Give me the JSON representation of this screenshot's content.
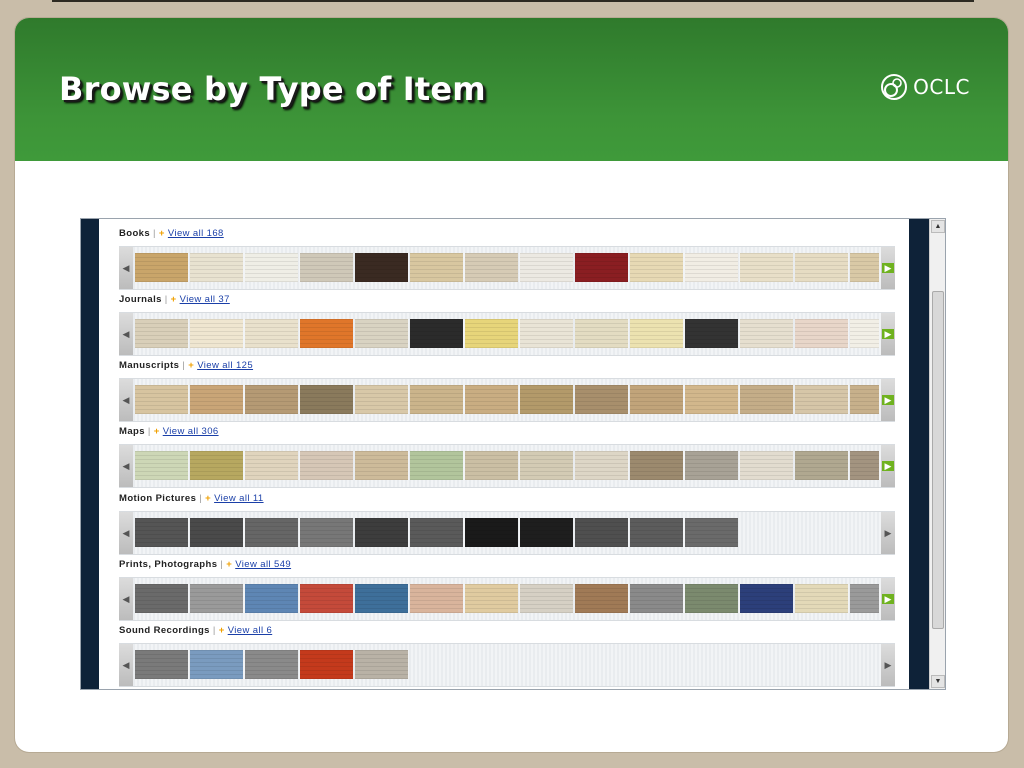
{
  "slide": {
    "title": "Browse by Type of Item",
    "logo_text": "OCLC",
    "header_color": "#3f9a3a"
  },
  "browse": {
    "sections": [
      {
        "name": "Books",
        "link": "View all 168",
        "thumbs": [
          "#c9a56a",
          "#e8e2d0",
          "#efeee6",
          "#cfc8b8",
          "#3a2a22",
          "#d8c7a0",
          "#d6cbb5",
          "#ece9e2",
          "#8a1e22",
          "#e7d9b4",
          "#f1ede4",
          "#e8dfc8",
          "#e6dcc3",
          "#d9c9a6"
        ]
      },
      {
        "name": "Journals",
        "link": "View all 37",
        "thumbs": [
          "#d9cfb9",
          "#efe6d0",
          "#e9e1cc",
          "#e0762a",
          "#d9d3c2",
          "#2b2b2b",
          "#e7d57a",
          "#e9e4d6",
          "#e3dcc2",
          "#ece2b0",
          "#333333",
          "#e6dfcf",
          "#e8d6c9",
          "#f2efe6",
          "#e8e4dc",
          "#d9cfb8"
        ]
      },
      {
        "name": "Manuscripts",
        "link": "View all 125",
        "thumbs": [
          "#d7c4a0",
          "#c9a577",
          "#b59a74",
          "#8a7a5c",
          "#d8c8a8",
          "#cbb48b",
          "#c9ad82",
          "#b39a6a",
          "#a88f6c",
          "#c1a47a",
          "#d2b78c",
          "#c4ad88",
          "#d6c6a8",
          "#c7b08b"
        ]
      },
      {
        "name": "Maps",
        "link": "View all 306",
        "thumbs": [
          "#cdd7b6",
          "#b7a860",
          "#e0d4bd",
          "#d6c7b6",
          "#cdbb9a",
          "#b2c59c",
          "#cbbfa4",
          "#d3cbb4",
          "#ddd6c6",
          "#9c8a6e",
          "#a8a296",
          "#e2dccf",
          "#b0a890",
          "#a39480"
        ]
      },
      {
        "name": "Motion Pictures",
        "link": "View all 11",
        "thumbs": [
          "#555555",
          "#4a4a4a",
          "#666666",
          "#777777",
          "#3d3d3d",
          "#5a5a5a",
          "#1a1a1a",
          "#1e1e1e",
          "#4f4f4f",
          "#5c5c5c",
          "#6a6a6a"
        ]
      },
      {
        "name": "Prints, Photographs",
        "link": "View all 549",
        "thumbs": [
          "#6a6a6a",
          "#9a9a9a",
          "#5e86b4",
          "#c44a3a",
          "#3e6f9a",
          "#d9b49c",
          "#e0cba0",
          "#d6d0c4",
          "#a07a56",
          "#8a8a8a",
          "#7b8a6e",
          "#2c3f7a",
          "#e3d9b8",
          "#9a9a9a"
        ]
      },
      {
        "name": "Sound Recordings",
        "link": "View all 6",
        "thumbs": [
          "#7a7a7a",
          "#7a9bbf",
          "#8a8a8a",
          "#c43a1c",
          "#b9b2a6"
        ]
      }
    ]
  }
}
